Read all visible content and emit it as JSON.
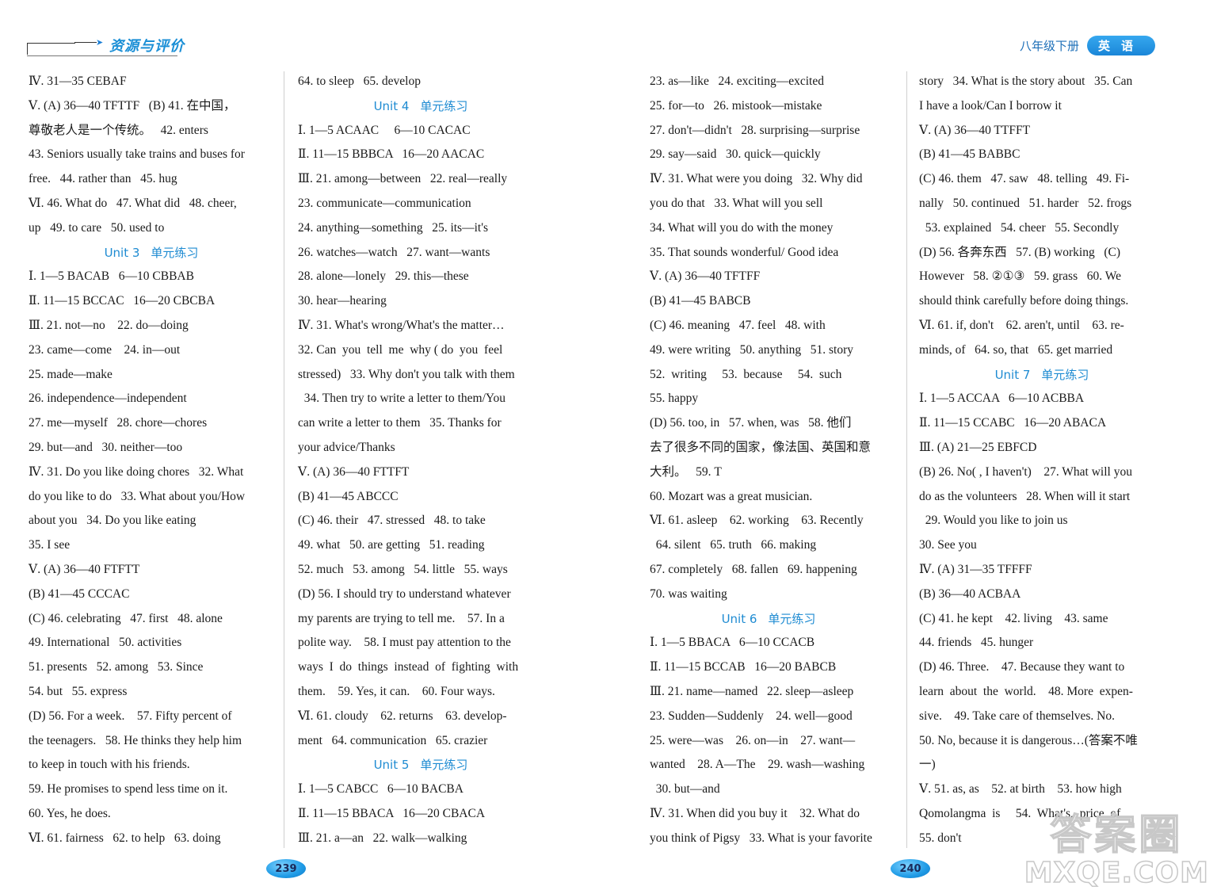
{
  "header": {
    "logo_text": "资源与评价",
    "grade": "八年级下册",
    "subject": "英语"
  },
  "left_page": {
    "page_number": "239",
    "col1": [
      {
        "type": "line",
        "text": "Ⅳ. 31—35 CEBAF"
      },
      {
        "type": "line",
        "text": "Ⅴ. (A) 36—40 TFTTF   (B) 41. 在中国，"
      },
      {
        "type": "line",
        "text": "尊敬老人是一个传统。   42. enters"
      },
      {
        "type": "line",
        "text": "43. Seniors usually take trains and buses for"
      },
      {
        "type": "line",
        "text": "free.   44. rather than   45. hug"
      },
      {
        "type": "line",
        "text": "Ⅵ. 46. What do   47. What did   48. cheer,"
      },
      {
        "type": "line",
        "text": "up   49. to care   50. used to"
      },
      {
        "type": "unit",
        "unit": "Unit 3",
        "label": "单元练习"
      },
      {
        "type": "line",
        "text": "Ⅰ. 1—5 BACAB   6—10 CBBAB"
      },
      {
        "type": "line",
        "text": "Ⅱ. 11—15 BCCAC   16—20 CBCBA"
      },
      {
        "type": "line",
        "text": "Ⅲ. 21. not—no    22. do—doing"
      },
      {
        "type": "line",
        "text": "23. came—come    24. in—out"
      },
      {
        "type": "line",
        "text": "25. made—make"
      },
      {
        "type": "line",
        "text": "26. independence—independent"
      },
      {
        "type": "line",
        "text": "27. me—myself   28. chore—chores"
      },
      {
        "type": "line",
        "text": "29. but—and   30. neither—too"
      },
      {
        "type": "line",
        "text": "Ⅳ. 31. Do you like doing chores   32. What"
      },
      {
        "type": "line",
        "text": "do you like to do   33. What about you/How"
      },
      {
        "type": "line",
        "text": "about you   34. Do you like eating"
      },
      {
        "type": "line",
        "text": "35. I see"
      },
      {
        "type": "line",
        "text": "Ⅴ. (A) 36—40 FTFTT"
      },
      {
        "type": "line",
        "text": "(B) 41—45 CCCAC"
      },
      {
        "type": "line",
        "text": "(C) 46. celebrating   47. first   48. alone"
      },
      {
        "type": "line",
        "text": "49. International   50. activities"
      },
      {
        "type": "line",
        "text": "51. presents   52. among   53. Since"
      },
      {
        "type": "line",
        "text": "54. but   55. express"
      },
      {
        "type": "line",
        "text": "(D) 56. For a week.    57. Fifty percent of"
      },
      {
        "type": "line",
        "text": "the teenagers.   58. He thinks they help him"
      },
      {
        "type": "line",
        "text": "to keep in touch with his friends."
      },
      {
        "type": "line",
        "text": "59. He promises to spend less time on it."
      },
      {
        "type": "line",
        "text": "60. Yes, he does."
      },
      {
        "type": "line",
        "text": "Ⅵ. 61. fairness   62. to help   63. doing"
      }
    ],
    "col2": [
      {
        "type": "line",
        "text": "64. to sleep   65. develop"
      },
      {
        "type": "unit",
        "unit": "Unit 4",
        "label": "单元练习"
      },
      {
        "type": "line",
        "text": "Ⅰ. 1—5 ACAAC     6—10 CACAC"
      },
      {
        "type": "line",
        "text": "Ⅱ. 11—15 BBBCA   16—20 AACAC"
      },
      {
        "type": "line",
        "text": "Ⅲ. 21. among—between   22. real—really"
      },
      {
        "type": "line",
        "text": "23. communicate—communication"
      },
      {
        "type": "line",
        "text": "24. anything—something   25. its—it's"
      },
      {
        "type": "line",
        "text": "26. watches—watch   27. want—wants"
      },
      {
        "type": "line",
        "text": "28. alone—lonely   29. this—these"
      },
      {
        "type": "line",
        "text": "30. hear—hearing"
      },
      {
        "type": "line",
        "text": "Ⅳ. 31. What's wrong/What's the matter…"
      },
      {
        "type": "line",
        "text": "32. Can  you  tell  me  why ( do  you  feel"
      },
      {
        "type": "line",
        "text": "stressed)   33. Why don't you talk with them"
      },
      {
        "type": "line",
        "text": "  34. Then try to write a letter to them/You"
      },
      {
        "type": "line",
        "text": "can write a letter to them   35. Thanks for"
      },
      {
        "type": "line",
        "text": "your advice/Thanks"
      },
      {
        "type": "line",
        "text": "Ⅴ. (A) 36—40 FTTFT"
      },
      {
        "type": "line",
        "text": "(B) 41—45 ABCCC"
      },
      {
        "type": "line",
        "text": "(C) 46. their   47. stressed   48. to take"
      },
      {
        "type": "line",
        "text": "49. what   50. are getting   51. reading"
      },
      {
        "type": "line",
        "text": "52. much   53. among   54. little   55. ways"
      },
      {
        "type": "line",
        "text": "(D) 56. I should try to understand whatever"
      },
      {
        "type": "line",
        "text": "my parents are trying to tell me.    57. In a"
      },
      {
        "type": "line",
        "text": "polite way.    58. I must pay attention to the"
      },
      {
        "type": "line",
        "text": "ways  I  do  things  instead  of  fighting  with"
      },
      {
        "type": "line",
        "text": "them.    59. Yes, it can.    60. Four ways."
      },
      {
        "type": "line",
        "text": "Ⅵ. 61. cloudy    62. returns    63. develop-"
      },
      {
        "type": "line",
        "text": "ment   64. communication   65. crazier"
      },
      {
        "type": "unit",
        "unit": "Unit 5",
        "label": "单元练习"
      },
      {
        "type": "line",
        "text": "Ⅰ. 1—5 CABCC   6—10 BACBA"
      },
      {
        "type": "line",
        "text": "Ⅱ. 11—15 BBACA   16—20 CBACA"
      },
      {
        "type": "line",
        "text": "Ⅲ. 21. a—an   22. walk—walking"
      }
    ]
  },
  "right_page": {
    "page_number": "240",
    "col1": [
      {
        "type": "line",
        "text": "23. as—like   24. exciting—excited"
      },
      {
        "type": "line",
        "text": "25. for—to   26. mistook—mistake"
      },
      {
        "type": "line",
        "text": "27. don't—didn't   28. surprising—surprise"
      },
      {
        "type": "line",
        "text": "29. say—said   30. quick—quickly"
      },
      {
        "type": "line",
        "text": "Ⅳ. 31. What were you doing   32. Why did"
      },
      {
        "type": "line",
        "text": "you do that   33. What will you sell"
      },
      {
        "type": "line",
        "text": "34. What will you do with the money"
      },
      {
        "type": "line",
        "text": "35. That sounds wonderful/ Good idea"
      },
      {
        "type": "line",
        "text": "Ⅴ. (A) 36—40 TFTFF"
      },
      {
        "type": "line",
        "text": "(B) 41—45 BABCB"
      },
      {
        "type": "line",
        "text": "(C) 46. meaning   47. feel   48. with"
      },
      {
        "type": "line",
        "text": "49. were writing   50. anything   51. story"
      },
      {
        "type": "line",
        "text": "52.  writing     53.  because     54.  such"
      },
      {
        "type": "line",
        "text": "55. happy"
      },
      {
        "type": "line",
        "text": "(D) 56. too, in   57. when, was   58. 他们"
      },
      {
        "type": "line",
        "text": "去了很多不同的国家，像法国、英国和意"
      },
      {
        "type": "line",
        "text": "大利。   59. T"
      },
      {
        "type": "line",
        "text": "60. Mozart was a great musician."
      },
      {
        "type": "line",
        "text": "Ⅵ. 61. asleep    62. working    63. Recently"
      },
      {
        "type": "line",
        "text": "  64. silent   65. truth   66. making"
      },
      {
        "type": "line",
        "text": "67. completely   68. fallen   69. happening"
      },
      {
        "type": "line",
        "text": "70. was waiting"
      },
      {
        "type": "unit",
        "unit": "Unit 6",
        "label": "单元练习"
      },
      {
        "type": "line",
        "text": "Ⅰ. 1—5 BBACA   6—10 CCACB"
      },
      {
        "type": "line",
        "text": "Ⅱ. 11—15 BCCAB   16—20 BABCB"
      },
      {
        "type": "line",
        "text": "Ⅲ. 21. name—named   22. sleep—asleep"
      },
      {
        "type": "line",
        "text": "23. Sudden—Suddenly    24. well—good"
      },
      {
        "type": "line",
        "text": "25. were—was    26. on—in    27. want—"
      },
      {
        "type": "line",
        "text": "wanted    28. A—The    29. wash—washing"
      },
      {
        "type": "line",
        "text": "  30. but—and"
      },
      {
        "type": "line",
        "text": "Ⅳ. 31. When did you buy it    32. What do"
      },
      {
        "type": "line",
        "text": "you think of Pigsy   33. What is your favorite"
      }
    ],
    "col2": [
      {
        "type": "line",
        "text": "story   34. What is the story about   35. Can"
      },
      {
        "type": "line",
        "text": "I have a look/Can I borrow it"
      },
      {
        "type": "line",
        "text": "Ⅴ. (A) 36—40 TTFFT"
      },
      {
        "type": "line",
        "text": "(B) 41—45 BABBC"
      },
      {
        "type": "line",
        "text": "(C) 46. them   47. saw   48. telling   49. Fi-"
      },
      {
        "type": "line",
        "text": "nally   50. continued   51. harder   52. frogs"
      },
      {
        "type": "line",
        "text": "  53. explained   54. cheer   55. Secondly"
      },
      {
        "type": "line",
        "text": "(D) 56. 各奔东西   57. (B) working   (C)"
      },
      {
        "type": "line",
        "text": "However   58. ②①③   59. grass   60. We"
      },
      {
        "type": "line",
        "text": "should think carefully before doing things."
      },
      {
        "type": "line",
        "text": "Ⅵ. 61. if, don't    62. aren't, until    63. re-"
      },
      {
        "type": "line",
        "text": "minds, of   64. so, that   65. get married"
      },
      {
        "type": "unit",
        "unit": "Unit 7",
        "label": "单元练习"
      },
      {
        "type": "line",
        "text": "Ⅰ. 1—5 ACCAA   6—10 ACBBA"
      },
      {
        "type": "line",
        "text": "Ⅱ. 11—15 CCABC   16—20 ABACA"
      },
      {
        "type": "line",
        "text": "Ⅲ. (A) 21—25 EBFCD"
      },
      {
        "type": "line",
        "text": "(B) 26. No( , I haven't)    27. What will you"
      },
      {
        "type": "line",
        "text": "do as the volunteers   28. When will it start"
      },
      {
        "type": "line",
        "text": "  29. Would you like to join us"
      },
      {
        "type": "line",
        "text": "30. See you"
      },
      {
        "type": "line",
        "text": "Ⅳ. (A) 31—35 TFFFF"
      },
      {
        "type": "line",
        "text": "(B) 36—40 ACBAA"
      },
      {
        "type": "line",
        "text": "(C) 41. he kept    42. living    43. same"
      },
      {
        "type": "line",
        "text": "44. friends   45. hunger"
      },
      {
        "type": "line",
        "text": "(D) 46. Three.    47. Because they want to"
      },
      {
        "type": "line",
        "text": "learn  about  the  world.    48. More  expen-"
      },
      {
        "type": "line",
        "text": "sive.    49. Take care of themselves. No."
      },
      {
        "type": "line",
        "text": "50. No, because it is dangerous…(答案不唯"
      },
      {
        "type": "line",
        "text": "一)"
      },
      {
        "type": "line",
        "text": "Ⅴ. 51. as, as    52. at birth    53. how high"
      },
      {
        "type": "line",
        "text": "Qomolangma  is     54.  What's,  price  of"
      },
      {
        "type": "line",
        "text": "55. don't"
      }
    ]
  },
  "watermark": {
    "top": "答案圈",
    "bottom": "MXQE.COM"
  },
  "colors": {
    "accent_blue": "#1e8bd2",
    "badge_blue": "#1f9be6"
  }
}
